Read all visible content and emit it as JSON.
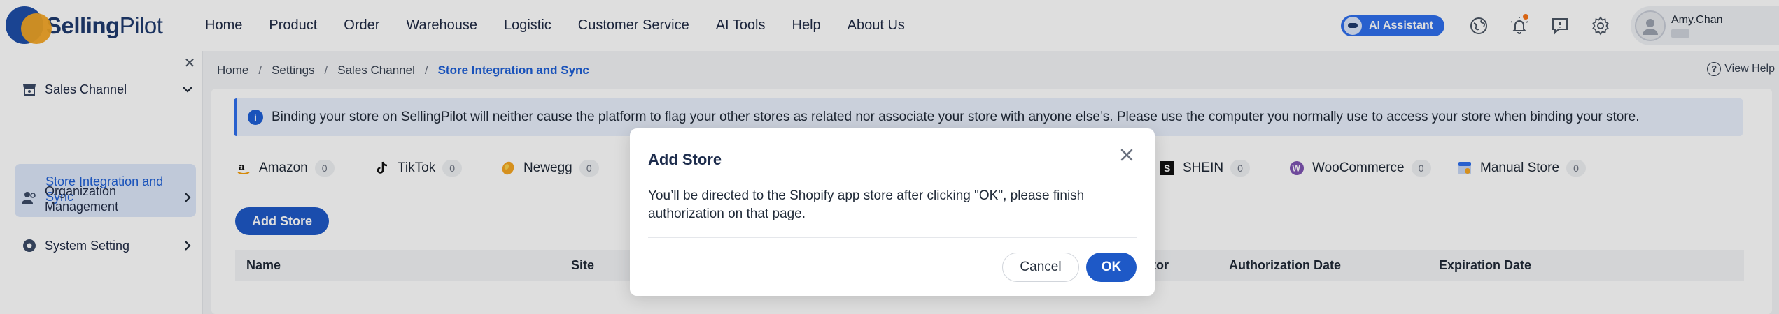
{
  "brand": {
    "name_bold": "Selling",
    "name_rest": "Pilot",
    "colors": {
      "primary": "#1e4fa8",
      "accent": "#f5a623"
    }
  },
  "nav": [
    {
      "label": "Home"
    },
    {
      "label": "Product"
    },
    {
      "label": "Order"
    },
    {
      "label": "Warehouse"
    },
    {
      "label": "Logistic"
    },
    {
      "label": "Customer Service"
    },
    {
      "label": "AI Tools"
    },
    {
      "label": "Help"
    },
    {
      "label": "About Us"
    }
  ],
  "top_right": {
    "ai_assistant_label": "AI Assistant",
    "user_name": "Amy.Chan",
    "icons": [
      "globe-icon",
      "bell-icon",
      "message-icon",
      "gear-icon"
    ]
  },
  "sidebar": {
    "groups": [
      {
        "label": "Sales Channel",
        "icon": "store-icon",
        "expanded": true
      },
      {
        "label": "Organization Management",
        "icon": "users-icon",
        "expanded": false
      },
      {
        "label": "System Setting",
        "icon": "gear-icon",
        "expanded": false
      }
    ],
    "active_item": "Store Integration and Sync"
  },
  "breadcrumb": [
    "Home",
    "Settings",
    "Sales Channel",
    "Store Integration and Sync"
  ],
  "view_help_label": "View Help",
  "notice": "Binding your store on SellingPilot will neither cause the platform to flag your other stores as related nor associate your store with anyone else’s. Please use the computer you normally use to access your store when binding your store.",
  "tabs": [
    {
      "name": "Amazon",
      "count": "0",
      "icon": "amazon-icon"
    },
    {
      "name": "TikTok",
      "count": "0",
      "icon": "tiktok-icon"
    },
    {
      "name": "Newegg",
      "count": "0",
      "icon": "newegg-icon"
    },
    {
      "name": "SHEIN",
      "count": "0",
      "icon": "shein-icon"
    },
    {
      "name": "WooCommerce",
      "count": "0",
      "icon": "woocommerce-icon"
    },
    {
      "name": "Manual Store",
      "count": "0",
      "icon": "manual-store-icon"
    }
  ],
  "add_store_label": "Add Store",
  "table": {
    "columns": [
      "Name",
      "Site",
      "ator",
      "Authorization Date",
      "Expiration Date"
    ]
  },
  "modal": {
    "title": "Add Store",
    "body": "You’ll be directed to the Shopify app store after clicking \"OK\", please finish authorization on that page.",
    "cancel_label": "Cancel",
    "ok_label": "OK"
  }
}
